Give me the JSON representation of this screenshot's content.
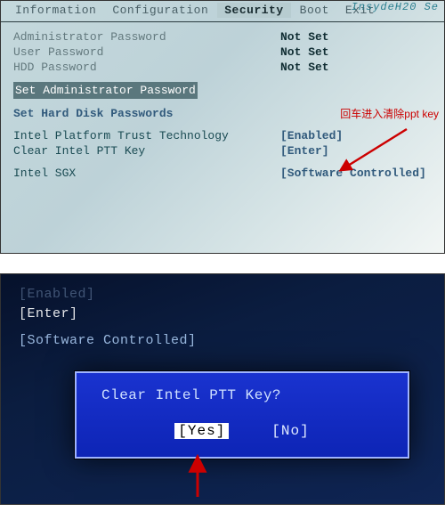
{
  "brand": "InsydeH20 Se",
  "menu": {
    "items": [
      "Information",
      "Configuration",
      "Security",
      "Boot",
      "Exit"
    ],
    "active": "Security"
  },
  "security": {
    "admin_pw_label": "Administrator Password",
    "admin_pw_val": "Not Set",
    "user_pw_label": "User Password",
    "user_pw_val": "Not Set",
    "hdd_pw_label": "HDD Password",
    "hdd_pw_val": "Not Set",
    "set_admin_pw": "Set Administrator Password",
    "set_hdd_pw": "Set Hard Disk Passwords",
    "ptt_label": "Intel Platform Trust Technology",
    "ptt_val": "[Enabled]",
    "clear_ptt_label": "Clear Intel PTT Key",
    "clear_ptt_val": "[Enter]",
    "sgx_label": "Intel SGX",
    "sgx_val": "[Software Controlled]"
  },
  "annotation": "回车进入清除ppt key",
  "dialog_context": {
    "line0": "[Enabled]",
    "line1": "[Enter]",
    "line2": "[Software Controlled]"
  },
  "dialog": {
    "question": "Clear Intel PTT Key?",
    "yes": "[Yes]",
    "no": "[No]"
  }
}
